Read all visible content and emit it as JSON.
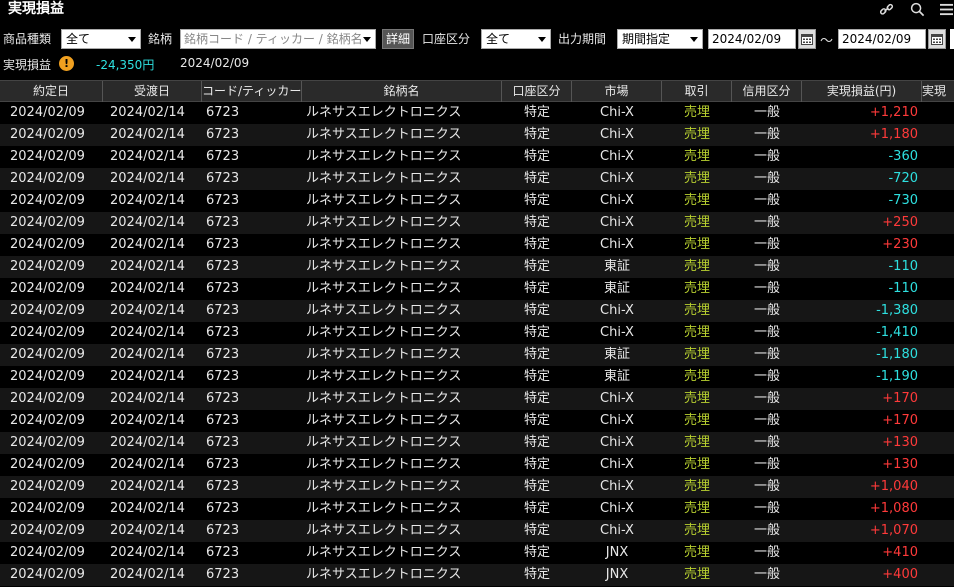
{
  "window": {
    "title": "実現損益"
  },
  "toolbar_icons": [
    "link-icon",
    "search-icon",
    "menu-icon"
  ],
  "filters": {
    "product_label": "商品種類",
    "product_value": "全て",
    "symbol_label": "銘柄",
    "symbol_placeholder": "銘柄コード / ティッカー / 銘柄名",
    "detail_button": "詳細",
    "account_label": "口座区分",
    "account_value": "全て",
    "period_label": "出力期間",
    "period_value": "期間指定",
    "date_from": "2024/02/09",
    "date_separator": "～",
    "date_to": "2024/02/09"
  },
  "summary": {
    "label": "実現損益",
    "value": "-24,350円",
    "date": "2024/02/09"
  },
  "table": {
    "columns": [
      "約定日",
      "受渡日",
      "コード/ティッカー",
      "銘柄名",
      "口座区分",
      "市場",
      "取引",
      "信用区分",
      "実現損益(円)",
      "実現"
    ],
    "rows": [
      {
        "yaku": "2024/02/09",
        "uke": "2024/02/14",
        "code": "6723",
        "name": "ルネサスエレクトロニクス",
        "koza": "特定",
        "mkt": "Chi-X",
        "tori": "売埋",
        "shin": "一般",
        "pl": "+1,210",
        "sign": "pos"
      },
      {
        "yaku": "2024/02/09",
        "uke": "2024/02/14",
        "code": "6723",
        "name": "ルネサスエレクトロニクス",
        "koza": "特定",
        "mkt": "Chi-X",
        "tori": "売埋",
        "shin": "一般",
        "pl": "+1,180",
        "sign": "pos"
      },
      {
        "yaku": "2024/02/09",
        "uke": "2024/02/14",
        "code": "6723",
        "name": "ルネサスエレクトロニクス",
        "koza": "特定",
        "mkt": "Chi-X",
        "tori": "売埋",
        "shin": "一般",
        "pl": "-360",
        "sign": "neg"
      },
      {
        "yaku": "2024/02/09",
        "uke": "2024/02/14",
        "code": "6723",
        "name": "ルネサスエレクトロニクス",
        "koza": "特定",
        "mkt": "Chi-X",
        "tori": "売埋",
        "shin": "一般",
        "pl": "-720",
        "sign": "neg"
      },
      {
        "yaku": "2024/02/09",
        "uke": "2024/02/14",
        "code": "6723",
        "name": "ルネサスエレクトロニクス",
        "koza": "特定",
        "mkt": "Chi-X",
        "tori": "売埋",
        "shin": "一般",
        "pl": "-730",
        "sign": "neg"
      },
      {
        "yaku": "2024/02/09",
        "uke": "2024/02/14",
        "code": "6723",
        "name": "ルネサスエレクトロニクス",
        "koza": "特定",
        "mkt": "Chi-X",
        "tori": "売埋",
        "shin": "一般",
        "pl": "+250",
        "sign": "pos"
      },
      {
        "yaku": "2024/02/09",
        "uke": "2024/02/14",
        "code": "6723",
        "name": "ルネサスエレクトロニクス",
        "koza": "特定",
        "mkt": "Chi-X",
        "tori": "売埋",
        "shin": "一般",
        "pl": "+230",
        "sign": "pos"
      },
      {
        "yaku": "2024/02/09",
        "uke": "2024/02/14",
        "code": "6723",
        "name": "ルネサスエレクトロニクス",
        "koza": "特定",
        "mkt": "東証",
        "tori": "売埋",
        "shin": "一般",
        "pl": "-110",
        "sign": "neg"
      },
      {
        "yaku": "2024/02/09",
        "uke": "2024/02/14",
        "code": "6723",
        "name": "ルネサスエレクトロニクス",
        "koza": "特定",
        "mkt": "東証",
        "tori": "売埋",
        "shin": "一般",
        "pl": "-110",
        "sign": "neg"
      },
      {
        "yaku": "2024/02/09",
        "uke": "2024/02/14",
        "code": "6723",
        "name": "ルネサスエレクトロニクス",
        "koza": "特定",
        "mkt": "Chi-X",
        "tori": "売埋",
        "shin": "一般",
        "pl": "-1,380",
        "sign": "neg"
      },
      {
        "yaku": "2024/02/09",
        "uke": "2024/02/14",
        "code": "6723",
        "name": "ルネサスエレクトロニクス",
        "koza": "特定",
        "mkt": "Chi-X",
        "tori": "売埋",
        "shin": "一般",
        "pl": "-1,410",
        "sign": "neg"
      },
      {
        "yaku": "2024/02/09",
        "uke": "2024/02/14",
        "code": "6723",
        "name": "ルネサスエレクトロニクス",
        "koza": "特定",
        "mkt": "東証",
        "tori": "売埋",
        "shin": "一般",
        "pl": "-1,180",
        "sign": "neg"
      },
      {
        "yaku": "2024/02/09",
        "uke": "2024/02/14",
        "code": "6723",
        "name": "ルネサスエレクトロニクス",
        "koza": "特定",
        "mkt": "東証",
        "tori": "売埋",
        "shin": "一般",
        "pl": "-1,190",
        "sign": "neg"
      },
      {
        "yaku": "2024/02/09",
        "uke": "2024/02/14",
        "code": "6723",
        "name": "ルネサスエレクトロニクス",
        "koza": "特定",
        "mkt": "Chi-X",
        "tori": "売埋",
        "shin": "一般",
        "pl": "+170",
        "sign": "pos"
      },
      {
        "yaku": "2024/02/09",
        "uke": "2024/02/14",
        "code": "6723",
        "name": "ルネサスエレクトロニクス",
        "koza": "特定",
        "mkt": "Chi-X",
        "tori": "売埋",
        "shin": "一般",
        "pl": "+170",
        "sign": "pos"
      },
      {
        "yaku": "2024/02/09",
        "uke": "2024/02/14",
        "code": "6723",
        "name": "ルネサスエレクトロニクス",
        "koza": "特定",
        "mkt": "Chi-X",
        "tori": "売埋",
        "shin": "一般",
        "pl": "+130",
        "sign": "pos"
      },
      {
        "yaku": "2024/02/09",
        "uke": "2024/02/14",
        "code": "6723",
        "name": "ルネサスエレクトロニクス",
        "koza": "特定",
        "mkt": "Chi-X",
        "tori": "売埋",
        "shin": "一般",
        "pl": "+130",
        "sign": "pos"
      },
      {
        "yaku": "2024/02/09",
        "uke": "2024/02/14",
        "code": "6723",
        "name": "ルネサスエレクトロニクス",
        "koza": "特定",
        "mkt": "Chi-X",
        "tori": "売埋",
        "shin": "一般",
        "pl": "+1,040",
        "sign": "pos"
      },
      {
        "yaku": "2024/02/09",
        "uke": "2024/02/14",
        "code": "6723",
        "name": "ルネサスエレクトロニクス",
        "koza": "特定",
        "mkt": "Chi-X",
        "tori": "売埋",
        "shin": "一般",
        "pl": "+1,080",
        "sign": "pos"
      },
      {
        "yaku": "2024/02/09",
        "uke": "2024/02/14",
        "code": "6723",
        "name": "ルネサスエレクトロニクス",
        "koza": "特定",
        "mkt": "Chi-X",
        "tori": "売埋",
        "shin": "一般",
        "pl": "+1,070",
        "sign": "pos"
      },
      {
        "yaku": "2024/02/09",
        "uke": "2024/02/14",
        "code": "6723",
        "name": "ルネサスエレクトロニクス",
        "koza": "特定",
        "mkt": "JNX",
        "tori": "売埋",
        "shin": "一般",
        "pl": "+410",
        "sign": "pos"
      },
      {
        "yaku": "2024/02/09",
        "uke": "2024/02/14",
        "code": "6723",
        "name": "ルネサスエレクトロニクス",
        "koza": "特定",
        "mkt": "JNX",
        "tori": "売埋",
        "shin": "一般",
        "pl": "+400",
        "sign": "pos"
      }
    ]
  },
  "colors": {
    "positive": "#ff3a3a",
    "negative": "#2ee0e0",
    "trade": "#b8d030"
  }
}
